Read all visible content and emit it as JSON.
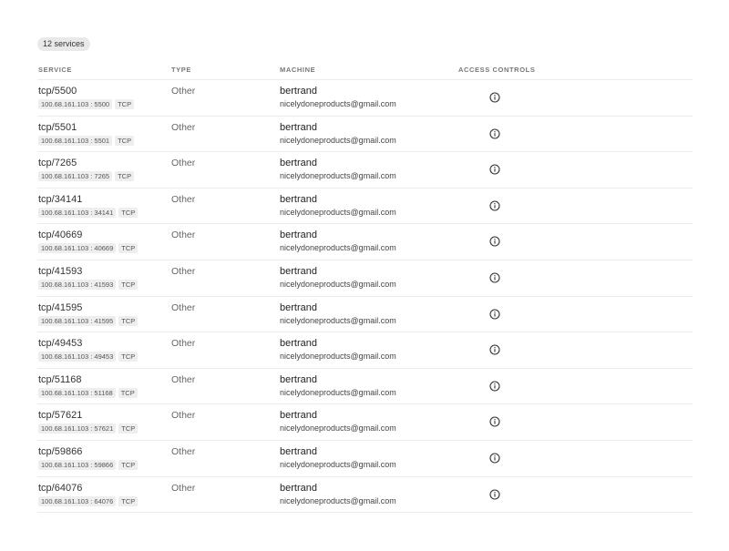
{
  "count_label": "12 services",
  "headers": {
    "service": "SERVICE",
    "type": "TYPE",
    "machine": "MACHINE",
    "access": "ACCESS CONTROLS"
  },
  "rows": [
    {
      "service": "tcp/5500",
      "ip": "100.68.161.103",
      "port": "5500",
      "proto": "TCP",
      "type": "Other",
      "machine": "bertrand",
      "owner": "nicelydoneproducts@gmail.com"
    },
    {
      "service": "tcp/5501",
      "ip": "100.68.161.103",
      "port": "5501",
      "proto": "TCP",
      "type": "Other",
      "machine": "bertrand",
      "owner": "nicelydoneproducts@gmail.com"
    },
    {
      "service": "tcp/7265",
      "ip": "100.68.161.103",
      "port": "7265",
      "proto": "TCP",
      "type": "Other",
      "machine": "bertrand",
      "owner": "nicelydoneproducts@gmail.com"
    },
    {
      "service": "tcp/34141",
      "ip": "100.68.161.103",
      "port": "34141",
      "proto": "TCP",
      "type": "Other",
      "machine": "bertrand",
      "owner": "nicelydoneproducts@gmail.com"
    },
    {
      "service": "tcp/40669",
      "ip": "100.68.161.103",
      "port": "40669",
      "proto": "TCP",
      "type": "Other",
      "machine": "bertrand",
      "owner": "nicelydoneproducts@gmail.com"
    },
    {
      "service": "tcp/41593",
      "ip": "100.68.161.103",
      "port": "41593",
      "proto": "TCP",
      "type": "Other",
      "machine": "bertrand",
      "owner": "nicelydoneproducts@gmail.com"
    },
    {
      "service": "tcp/41595",
      "ip": "100.68.161.103",
      "port": "41595",
      "proto": "TCP",
      "type": "Other",
      "machine": "bertrand",
      "owner": "nicelydoneproducts@gmail.com"
    },
    {
      "service": "tcp/49453",
      "ip": "100.68.161.103",
      "port": "49453",
      "proto": "TCP",
      "type": "Other",
      "machine": "bertrand",
      "owner": "nicelydoneproducts@gmail.com"
    },
    {
      "service": "tcp/51168",
      "ip": "100.68.161.103",
      "port": "51168",
      "proto": "TCP",
      "type": "Other",
      "machine": "bertrand",
      "owner": "nicelydoneproducts@gmail.com"
    },
    {
      "service": "tcp/57621",
      "ip": "100.68.161.103",
      "port": "57621",
      "proto": "TCP",
      "type": "Other",
      "machine": "bertrand",
      "owner": "nicelydoneproducts@gmail.com"
    },
    {
      "service": "tcp/59866",
      "ip": "100.68.161.103",
      "port": "59866",
      "proto": "TCP",
      "type": "Other",
      "machine": "bertrand",
      "owner": "nicelydoneproducts@gmail.com"
    },
    {
      "service": "tcp/64076",
      "ip": "100.68.161.103",
      "port": "64076",
      "proto": "TCP",
      "type": "Other",
      "machine": "bertrand",
      "owner": "nicelydoneproducts@gmail.com"
    }
  ]
}
